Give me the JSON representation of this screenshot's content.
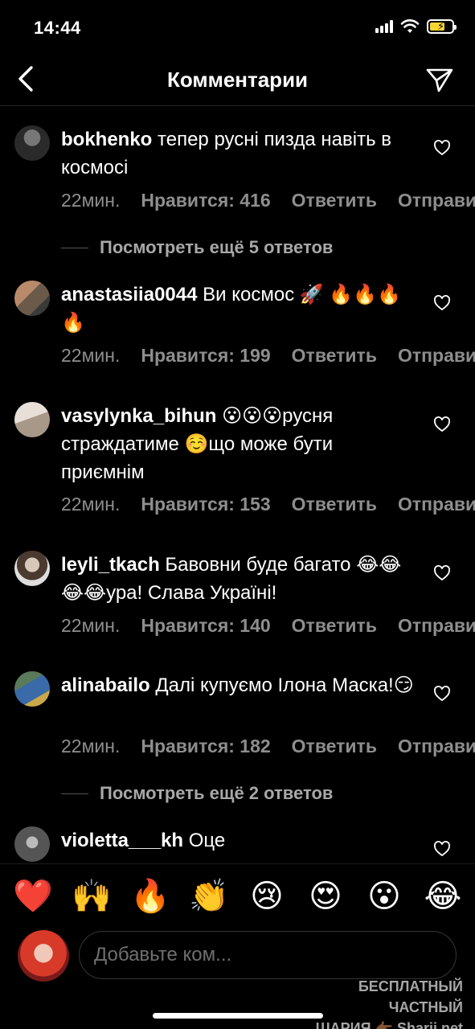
{
  "status_bar": {
    "time": "14:44"
  },
  "header": {
    "title": "Комментарии"
  },
  "comments": [
    {
      "username": "bokhenko",
      "text": "тепер русні пизда навіть в космосі",
      "time": "22мин.",
      "likes": "Нравится: 416",
      "reply": "Ответить",
      "send": "Отправить",
      "view_more": "Посмотреть ещё 5 ответов"
    },
    {
      "username": "anastasiia0044",
      "text": "Ви космос 🚀 🔥🔥🔥🔥",
      "time": "22мин.",
      "likes": "Нравится: 199",
      "reply": "Ответить",
      "send": "Отправить"
    },
    {
      "username": "vasylynka_bihun",
      "text": "😮😮😮русня страждатиме ☺️що може бути приємнім",
      "time": "22мин.",
      "likes": "Нравится: 153",
      "reply": "Ответить",
      "send": "Отправить"
    },
    {
      "username": "leyli_tkach",
      "text": "Бавовни буде багато 😂😂😂😂ура! Слава Україні!",
      "time": "22мин.",
      "likes": "Нравится: 140",
      "reply": "Ответить",
      "send": "Отправить"
    },
    {
      "username": "alinabailo",
      "text": "Далі купуємо Ілона Маска!😏",
      "time": "22мин.",
      "likes": "Нравится: 182",
      "reply": "Ответить",
      "send": "Отправить",
      "view_more": "Посмотреть ещё 2 ответов"
    },
    {
      "username": "violetta___kh",
      "text": "Оце"
    }
  ],
  "emoji_bar": [
    "❤️",
    "🙌",
    "🔥",
    "👏",
    "😢",
    "😍",
    "😮",
    "😂"
  ],
  "input": {
    "placeholder": "Добавьте ком..."
  },
  "watermark": {
    "line1": "БЕСПЛАТНЫЙ ЧАСТНЫЙ",
    "line2": "ШАРИЯ 👉🏾 Sharij.net"
  },
  "colors": {
    "background": "#000000",
    "secondary_text": "#8e8e8e",
    "divider": "#262626"
  }
}
